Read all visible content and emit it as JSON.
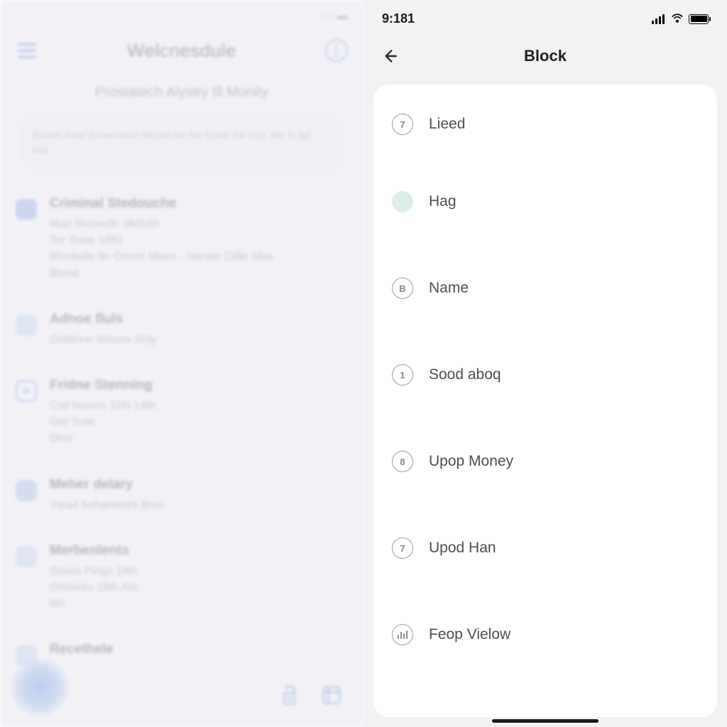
{
  "left": {
    "status_time": "",
    "title": "Welcnesdule",
    "subtitle": "Prostatech Alystry tll Monity",
    "card_text": "Bowns lintel Emserment Modes be the bome the nos. Me is apl. lote",
    "items": [
      {
        "title": "Criminal Stedouche",
        "body": "Man Recredit: 9MS/th\nTer Snee 1881\nBlockolie fin Omort Mters · Nerete Cillle Mas\nBlond"
      },
      {
        "title": "Adnoe fluls",
        "body": "Onldone Winors Shly"
      },
      {
        "title": "Fridne Stenning",
        "body": "Call bovers 10N 14th\nOer Snte\nDins"
      },
      {
        "title": "Meher delary",
        "body": "Yiead forhanteshi Bnol"
      },
      {
        "title": "Merbenlents",
        "body": "Soves Pings 18th\nOnheres 19th Aht\nitth"
      },
      {
        "title": "Recethele",
        "body": ""
      }
    ]
  },
  "right": {
    "status_time": "9:181",
    "title": "Block",
    "items": [
      {
        "icon_text": "7",
        "icon_variant": "ring",
        "label": "Lieed"
      },
      {
        "icon_text": "",
        "icon_variant": "solid",
        "label": "Hag"
      },
      {
        "icon_text": "B",
        "icon_variant": "ring",
        "label": "Name"
      },
      {
        "icon_text": "1",
        "icon_variant": "ring",
        "label": "Sood aboq"
      },
      {
        "icon_text": "8",
        "icon_variant": "ring",
        "label": "Upop Money"
      },
      {
        "icon_text": "7",
        "icon_variant": "ring",
        "label": "Upod Han"
      },
      {
        "icon_text": "",
        "icon_variant": "bars",
        "label": "Feop Vielow"
      }
    ]
  }
}
